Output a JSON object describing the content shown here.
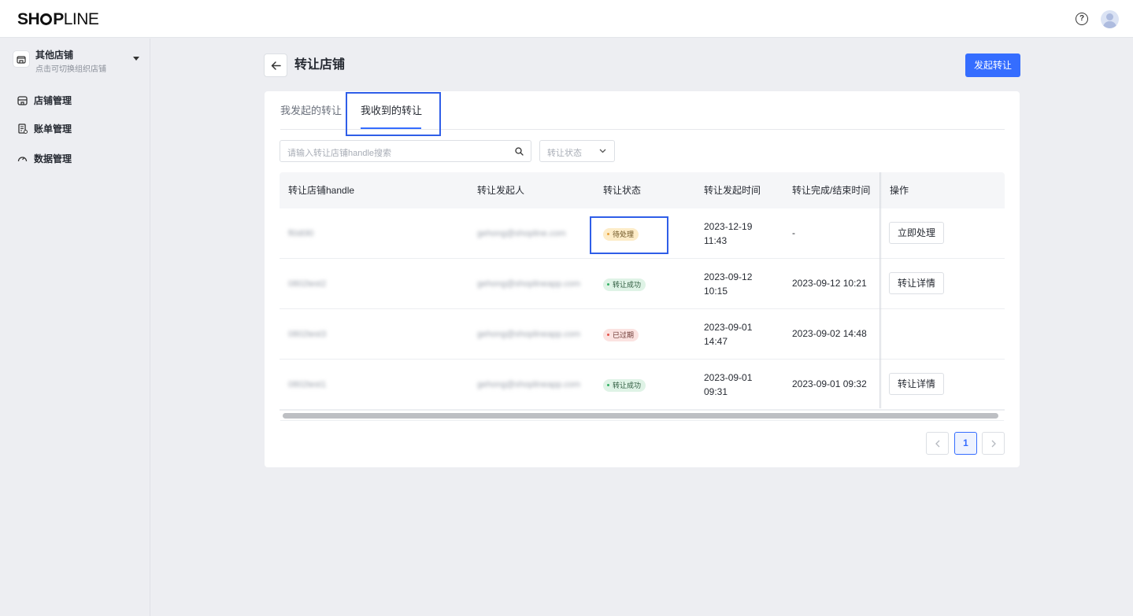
{
  "topbar": {
    "logo_bold": "SH",
    "logo_mid": "P",
    "logo_light": "LINE",
    "help_icon": "help-circle-icon",
    "avatar_icon": "user-avatar-icon"
  },
  "sidebar": {
    "org_name": "其他店铺",
    "org_sub": "点击可切换组织店铺",
    "items": [
      {
        "label": "店铺管理",
        "icon": "store-icon"
      },
      {
        "label": "账单管理",
        "icon": "bill-icon"
      },
      {
        "label": "数据管理",
        "icon": "dashboard-icon"
      }
    ]
  },
  "header": {
    "title": "转让店铺",
    "primary_button": "发起转让"
  },
  "tabs": [
    {
      "label": "我发起的转让",
      "active": false
    },
    {
      "label": "我收到的转让",
      "active": true
    }
  ],
  "filters": {
    "search_placeholder": "请输入转让店铺handle搜索",
    "status_placeholder": "转让状态"
  },
  "table": {
    "headers": [
      "转让店铺handle",
      "转让发起人",
      "转让状态",
      "转让发起时间",
      "转让完成/结束时间",
      "操作"
    ],
    "rows": [
      {
        "handle": "fl0d0l0",
        "initiator": "gehong@shopline.com",
        "status": "待处理",
        "status_type": "pending",
        "start_date": "2023-12-19",
        "start_time": "11:43",
        "end": "-",
        "action": "立即处理"
      },
      {
        "handle": "0802test2",
        "initiator": "gehong@shoplineapp.com",
        "status": "转让成功",
        "status_type": "success",
        "start_date": "2023-09-12",
        "start_time": "10:15",
        "end": "2023-09-12 10:21",
        "action": "转让详情"
      },
      {
        "handle": "0802test3",
        "initiator": "gehong@shoplineapp.com",
        "status": "已过期",
        "status_type": "expired",
        "start_date": "2023-09-01",
        "start_time": "14:47",
        "end": "2023-09-02 14:48",
        "action": ""
      },
      {
        "handle": "0802test1",
        "initiator": "gehong@shoplineapp.com",
        "status": "转让成功",
        "status_type": "success",
        "start_date": "2023-09-01",
        "start_time": "09:31",
        "end": "2023-09-01 09:32",
        "action": "转让详情"
      }
    ]
  },
  "pagination": {
    "current": "1"
  },
  "colors": {
    "accent": "#356dff",
    "highlight_box": "#2f5ee8",
    "pending": "#e8a33c",
    "success": "#36b266",
    "expired": "#e5534b"
  }
}
